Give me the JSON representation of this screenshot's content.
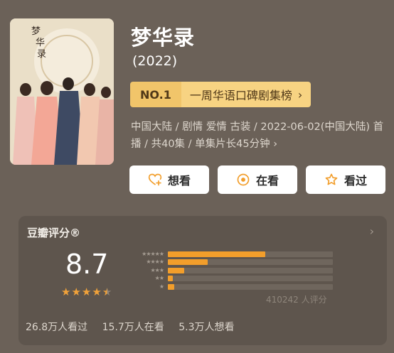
{
  "title": "梦华录",
  "year": "(2022)",
  "rank": {
    "no": "NO.1",
    "name": "一周华语口碑剧集榜",
    "chevron": "›"
  },
  "meta": {
    "line": "中国大陆 / 剧情 爱情 古装 / 2022-06-02(中国大陆) 首播 / 共40集 / 单集片长45分钟",
    "chevron": "›"
  },
  "actions": {
    "want": "想看",
    "watching": "在看",
    "watched": "看过"
  },
  "rating": {
    "title": "豆瓣评分®",
    "chevron": "›",
    "score": "8.7",
    "stars": 4.5,
    "distribution": [
      {
        "label": "★★★★★",
        "fraction": 0.59
      },
      {
        "label": "★★★★",
        "fraction": 0.24
      },
      {
        "label": "★★★",
        "fraction": 0.1
      },
      {
        "label": "★★",
        "fraction": 0.03
      },
      {
        "label": "★",
        "fraction": 0.04
      }
    ],
    "total": "410242 人评分",
    "counts": {
      "watched": "26.8万人看过",
      "watching": "15.7万人在看",
      "want": "5.3万人想看"
    }
  },
  "colors": {
    "accent": "#f29e2b",
    "rank_badge": "#f1c56a",
    "rank_bg": "#f7d382"
  },
  "icons": {
    "want": "heart-plus-icon",
    "watching": "target-circle-icon",
    "watched": "star-outline-icon"
  }
}
